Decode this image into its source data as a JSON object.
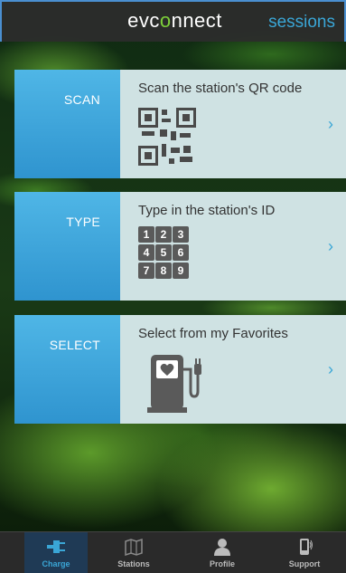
{
  "header": {
    "logo_prefix": "evc",
    "logo_accent": "o",
    "logo_suffix": "nnect",
    "sessions_label": "sessions"
  },
  "cards": [
    {
      "side_label": "SCAN",
      "title": "Scan the station's QR code",
      "icon": "qr-code-icon"
    },
    {
      "side_label": "TYPE",
      "title": "Type in the station's ID",
      "icon": "keypad-icon",
      "keys": [
        "1",
        "2",
        "3",
        "4",
        "5",
        "6",
        "7",
        "8",
        "9"
      ]
    },
    {
      "side_label": "SELECT",
      "title": "Select from my Favorites",
      "icon": "favorite-charger-icon"
    }
  ],
  "chevron": "›",
  "tabs": [
    {
      "label": "Charge",
      "icon": "charge-plug-icon",
      "active": true
    },
    {
      "label": "Stations",
      "icon": "map-icon",
      "active": false
    },
    {
      "label": "Profile",
      "icon": "person-icon",
      "active": false
    },
    {
      "label": "Support",
      "icon": "phone-icon",
      "active": false
    }
  ],
  "colors": {
    "accent_blue": "#3aa6d6",
    "logo_green": "#7dcf3a",
    "side_panel": "#2f94cf",
    "card_bg": "#cfe2e3"
  }
}
